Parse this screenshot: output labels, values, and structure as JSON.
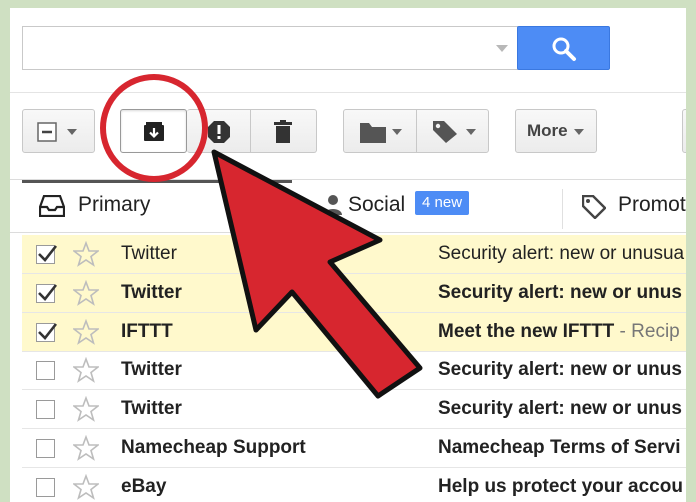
{
  "search": {
    "placeholder": ""
  },
  "icons": {
    "search": "search-icon",
    "select": "checkbox-select-icon",
    "archive": "archive-icon",
    "spam": "report-spam-icon",
    "delete": "trash-icon",
    "move": "folder-icon",
    "labels": "label-tag-icon",
    "star": "star-icon",
    "primary": "inbox-tray-icon",
    "social": "people-icon",
    "promotions": "tag-icon"
  },
  "toolbar": {
    "more_label": "More"
  },
  "tabs": [
    {
      "label": "Primary"
    },
    {
      "label": "Social",
      "badge": "4 new"
    },
    {
      "label": "Promoti"
    }
  ],
  "emails": [
    {
      "sender": "Twitter",
      "subject": "Security alert: new or unusua",
      "snippet": "",
      "selected": true,
      "unread": false
    },
    {
      "sender": "Twitter",
      "subject": "Security alert: new or unus",
      "snippet": "",
      "selected": true,
      "unread": true
    },
    {
      "sender": "IFTTT",
      "subject": "Meet the new IFTTT",
      "snippet": " - Recip",
      "selected": true,
      "unread": true
    },
    {
      "sender": "Twitter",
      "subject": "Security alert: new or unus",
      "snippet": "",
      "selected": false,
      "unread": true
    },
    {
      "sender": "Twitter",
      "subject": "Security alert: new or unus",
      "snippet": "",
      "selected": false,
      "unread": true
    },
    {
      "sender": "Namecheap Support",
      "subject": "Namecheap Terms of Servi",
      "snippet": "",
      "selected": false,
      "unread": true
    },
    {
      "sender": "eBay",
      "subject": "Help us protect your accou",
      "snippet": "",
      "selected": false,
      "unread": true
    }
  ],
  "colors": {
    "accent_blue": "#4d8cf5",
    "selected_row": "#fff9cc",
    "annotation_red": "#d7262f",
    "background_green": "#cfe0c2"
  }
}
